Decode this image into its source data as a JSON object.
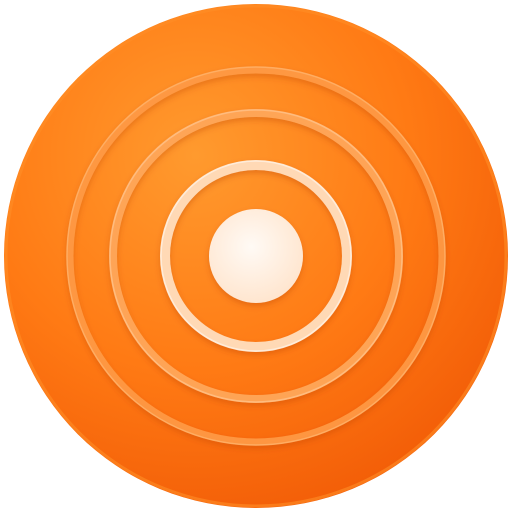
{
  "icon": {
    "name": "broadcast-signal-icon",
    "shape": "circle",
    "colors": {
      "base_light": "#ff9a2e",
      "base_mid": "#ff7a14",
      "base_dark": "#f15a06",
      "ring": "#ffb066",
      "ring_bright": "#ffe2c4",
      "center_dot": "#fff1e6"
    }
  }
}
